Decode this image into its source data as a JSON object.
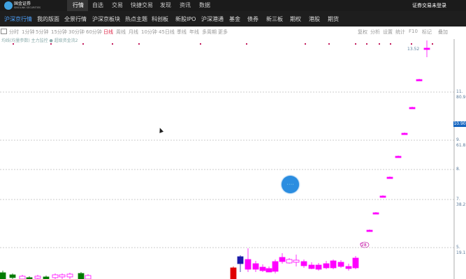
{
  "brand": {
    "name": "国金证券",
    "sub": "SINOLINK SECURITIES"
  },
  "top_nav": {
    "items": [
      "行情",
      "自选",
      "交易",
      "快捷交易",
      "发现",
      "资讯",
      "数据"
    ],
    "active": "行情",
    "login_label": "证券交易未登录"
  },
  "sub_nav": {
    "items": [
      "沪深京行情",
      "我的版面",
      "全景行情",
      "沪深京板块",
      "热点主题",
      "科创板",
      "新股IPO",
      "沪深港通",
      "基金",
      "债券",
      "新三板",
      "期权",
      "港股",
      "期货"
    ],
    "active": "沪深京行情"
  },
  "toolbar": {
    "periods": [
      "分时",
      "1分钟",
      "5分钟",
      "15分钟",
      "30分钟",
      "60分钟",
      "日线",
      "周线",
      "月线",
      "10分钟",
      "45日线",
      "季线",
      "年线",
      "多周期",
      "更多"
    ],
    "active_period": "日线",
    "right_items": [
      "复权",
      "分析",
      "设置",
      "统计",
      "F10",
      "标记",
      "叠加"
    ]
  },
  "indicator_line": "均线(均量参数) 主力监控 ● 超级资金流2",
  "axis_labels": {
    "price_top": "13.52",
    "right": [
      "11.",
      "80.9",
      "9.",
      "61.8",
      "8.",
      "7.",
      "38.2",
      "5.",
      "19.1"
    ],
    "current_price": "10.90"
  },
  "chart_markers": {
    "bubble": "28"
  },
  "colors": {
    "up": "#ff00ff",
    "down": "#007a00",
    "limit_up": "#e00000",
    "accent_blue": "#2b8de0"
  }
}
